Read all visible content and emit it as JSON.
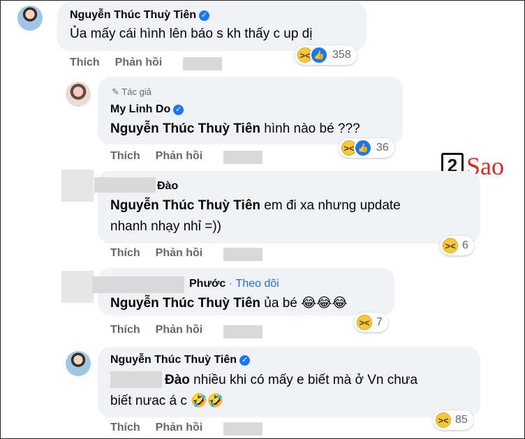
{
  "watermark": {
    "digit": "2",
    "text": "Sao"
  },
  "comments": [
    {
      "author": "Nguyễn Thúc Thuỳ Tiên",
      "text": "Ủa mấy cái hình lên báo s kh thấy c up dị",
      "reaction_count": "358",
      "like_label": "Thích",
      "reply_label": "Phản hồi"
    },
    {
      "author_tag": "Tác giả",
      "author": "My Linh Do",
      "mention": "Nguyễn Thúc Thuỳ Tiên",
      "text": " hình nào bé ???",
      "reaction_count": "36",
      "like_label": "Thích",
      "reply_label": "Phản hồi"
    },
    {
      "author": "Đào",
      "mention": "Nguyễn Thúc Thuỳ Tiên",
      "text_line1": " em đi xa nhưng update",
      "text_line2": "nhanh nhạy nhỉ =))",
      "reaction_count": "6",
      "like_label": "Thích",
      "reply_label": "Phản hồi"
    },
    {
      "author": "Phước",
      "follow_label": "Theo dõi",
      "mention": "Nguyễn Thúc Thuỳ Tiên",
      "text": " ủa bé 😂😂😂",
      "reaction_count": "7",
      "like_label": "Thích",
      "reply_label": "Phản hồi"
    },
    {
      "author": "Nguyễn Thúc Thuỳ Tiên",
      "mention": "Đào",
      "text_line1": " nhiều khi có mấy e biết mà ở Vn chưa",
      "text_line2": "biết nưac á c 🤣🤣",
      "reaction_count": "85",
      "like_label": "Thích",
      "reply_label": "Phản hồi"
    }
  ]
}
